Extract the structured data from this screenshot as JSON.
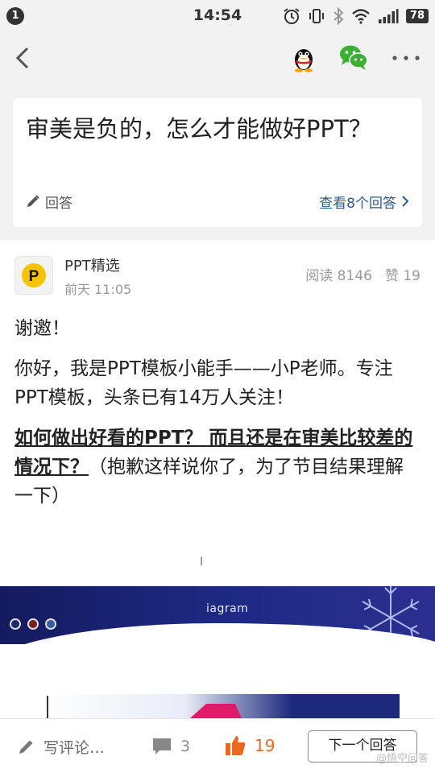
{
  "status_bar": {
    "notification_count": "1",
    "time": "14:54",
    "battery": "78",
    "icons": [
      "alarm-icon",
      "vibrate-icon",
      "bluetooth-icon",
      "wifi-icon",
      "signal-icon"
    ]
  },
  "nav": {
    "icons": [
      "back-icon",
      "qq-share-icon",
      "wechat-share-icon",
      "more-icon"
    ]
  },
  "question": {
    "title": "审美是负的，怎么才能做好PPT？",
    "answer_label": "回答",
    "view_answers_label": "查看8个回答"
  },
  "author": {
    "name": "PPT精选",
    "time": "前天 11:05",
    "avatar_letter": "P",
    "reads": "阅读 8146",
    "likes": "赞 19"
  },
  "content": {
    "p1": "谢邀！",
    "p2": "你好，我是PPT模板小能手——小P老师。专注PPT模板，头条已有14万人关注！",
    "p3_bold": "如何做出好看的PPT？ 而且还是在审美比较差的情况下？",
    "p3_rest": "（抱歉这样说你了，为了节目结果理解一下）",
    "cursor_mark": "I"
  },
  "slide": {
    "title": "iagram"
  },
  "bottom_bar": {
    "write_comment": "写评论…",
    "comment_count": "3",
    "like_count": "19",
    "next_answer": "下一个回答",
    "watermark": "@悟空问答"
  },
  "colors": {
    "accent_link": "#2a5a8c",
    "like_orange": "#f0661c",
    "background_gray": "#f2f2f2"
  }
}
